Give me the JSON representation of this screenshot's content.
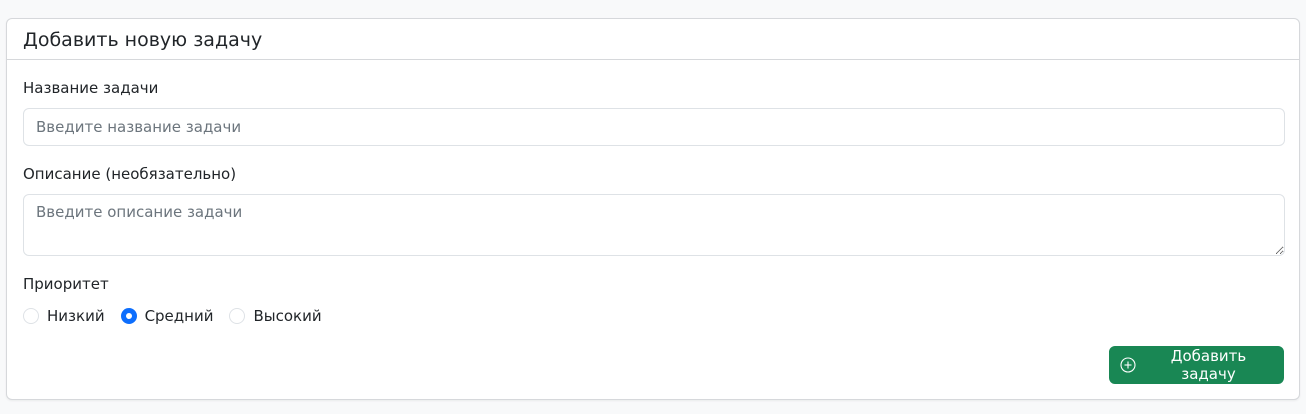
{
  "card": {
    "title": "Добавить новую задачу"
  },
  "form": {
    "title_label": "Название задачи",
    "title_placeholder": "Введите название задачи",
    "title_value": "",
    "description_label": "Описание (необязательно)",
    "description_placeholder": "Введите описание задачи",
    "description_value": "",
    "priority_label": "Приоритет",
    "priority_options": [
      {
        "label": "Низкий",
        "checked": false
      },
      {
        "label": "Средний",
        "checked": true
      },
      {
        "label": "Высокий",
        "checked": false
      }
    ],
    "submit_label": "Добавить задачу",
    "submit_icon": "plus-circle-icon"
  },
  "colors": {
    "accent": "#0d6efd",
    "success": "#198754"
  }
}
